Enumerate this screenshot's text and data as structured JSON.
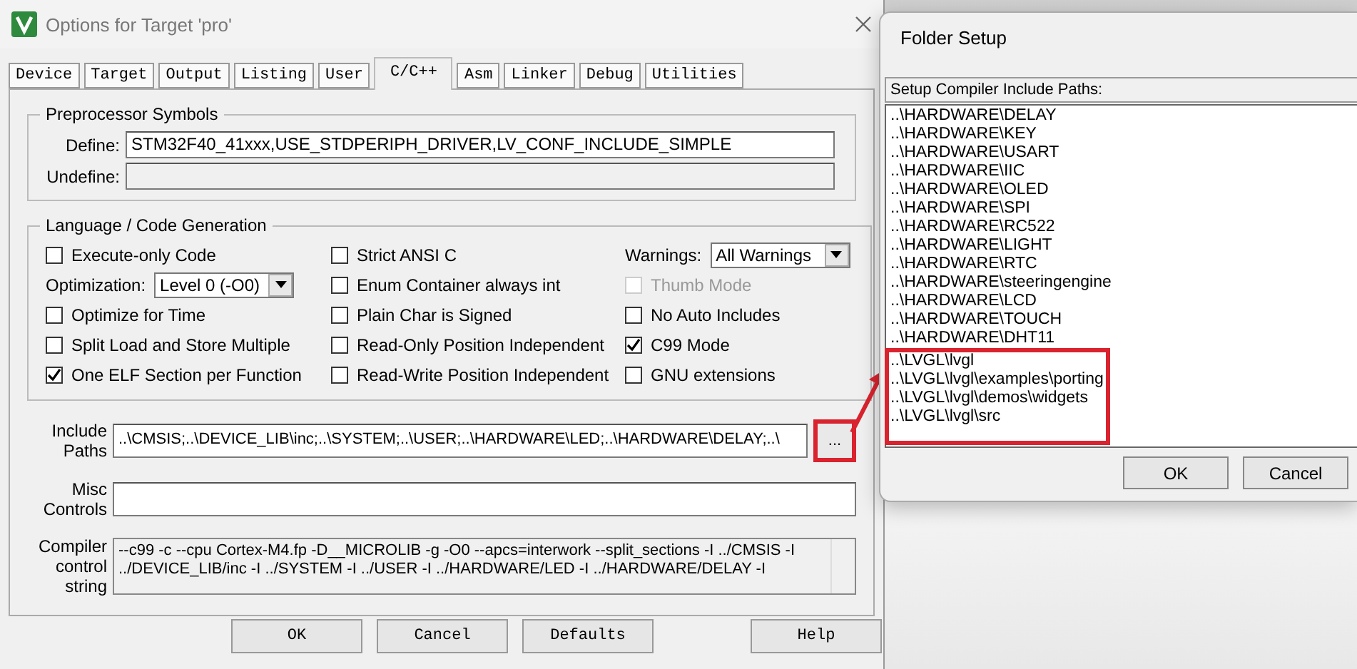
{
  "main_window": {
    "title": "Options for Target 'pro'"
  },
  "tabs": [
    {
      "label": "Device",
      "selected": false
    },
    {
      "label": "Target",
      "selected": false
    },
    {
      "label": "Output",
      "selected": false
    },
    {
      "label": "Listing",
      "selected": false
    },
    {
      "label": "User",
      "selected": false
    },
    {
      "label": "C/C++",
      "selected": true
    },
    {
      "label": "Asm",
      "selected": false
    },
    {
      "label": "Linker",
      "selected": false
    },
    {
      "label": "Debug",
      "selected": false
    },
    {
      "label": "Utilities",
      "selected": false
    }
  ],
  "preprocessor": {
    "title": "Preprocessor Symbols",
    "define_label": "Define:",
    "define_value": "STM32F40_41xxx,USE_STDPERIPH_DRIVER,LV_CONF_INCLUDE_SIMPLE",
    "undefine_label": "Undefine:"
  },
  "language": {
    "title": "Language / Code Generation",
    "columns": [
      [
        {
          "kind": "checkbox",
          "label": "Execute-only Code",
          "checked": false,
          "disabled": false
        },
        {
          "kind": "select",
          "label": "Optimization:",
          "value": "Level 0 (-O0)"
        },
        {
          "kind": "checkbox",
          "label": "Optimize for Time",
          "checked": false,
          "disabled": false
        },
        {
          "kind": "checkbox",
          "label": "Split Load and Store Multiple",
          "checked": false,
          "disabled": false
        },
        {
          "kind": "checkbox",
          "label": "One ELF Section per Function",
          "checked": true,
          "disabled": false
        }
      ],
      [
        {
          "kind": "checkbox",
          "label": "Strict ANSI C",
          "checked": false,
          "disabled": false
        },
        {
          "kind": "checkbox",
          "label": "Enum Container always int",
          "checked": false,
          "disabled": false
        },
        {
          "kind": "checkbox",
          "label": "Plain Char is Signed",
          "checked": false,
          "disabled": false
        },
        {
          "kind": "checkbox",
          "label": "Read-Only Position Independent",
          "checked": false,
          "disabled": false
        },
        {
          "kind": "checkbox",
          "label": "Read-Write Position Independent",
          "checked": false,
          "disabled": false
        }
      ],
      [
        {
          "kind": "select",
          "label": "Warnings:",
          "value": "All Warnings"
        },
        {
          "kind": "checkbox",
          "label": "Thumb Mode",
          "checked": false,
          "disabled": true
        },
        {
          "kind": "checkbox",
          "label": "No Auto Includes",
          "checked": false,
          "disabled": false
        },
        {
          "kind": "checkbox",
          "label": "C99 Mode",
          "checked": true,
          "disabled": false
        },
        {
          "kind": "checkbox",
          "label": "GNU extensions",
          "checked": false,
          "disabled": false
        }
      ]
    ]
  },
  "include_paths": {
    "label": "Include Paths",
    "value": "..\\CMSIS;..\\DEVICE_LIB\\inc;..\\SYSTEM;..\\USER;..\\HARDWARE\\LED;..\\HARDWARE\\DELAY;..\\",
    "browse": "...",
    "highlighted": true
  },
  "misc_controls": {
    "label": "Misc Controls"
  },
  "compiler_string": {
    "label": "Compiler control string",
    "value": "--c99 -c --cpu Cortex-M4.fp -D__MICROLIB -g -O0 --apcs=interwork --split_sections -I ../CMSIS -I ../DEVICE_LIB/inc -I ../SYSTEM -I ../USER -I ../HARDWARE/LED -I ../HARDWARE/DELAY -I"
  },
  "buttons": [
    "OK",
    "Cancel",
    "Defaults",
    "Help"
  ],
  "folder_setup": {
    "title": "Folder Setup",
    "list_label": "Setup Compiler Include Paths:",
    "paths": [
      {
        "text": "..\\HARDWARE\\DELAY",
        "highlighted": false
      },
      {
        "text": "..\\HARDWARE\\KEY",
        "highlighted": false
      },
      {
        "text": "..\\HARDWARE\\USART",
        "highlighted": false
      },
      {
        "text": "..\\HARDWARE\\IIC",
        "highlighted": false
      },
      {
        "text": "..\\HARDWARE\\OLED",
        "highlighted": false
      },
      {
        "text": "..\\HARDWARE\\SPI",
        "highlighted": false
      },
      {
        "text": "..\\HARDWARE\\RC522",
        "highlighted": false
      },
      {
        "text": "..\\HARDWARE\\LIGHT",
        "highlighted": false
      },
      {
        "text": "..\\HARDWARE\\RTC",
        "highlighted": false
      },
      {
        "text": "..\\HARDWARE\\steeringengine",
        "highlighted": false
      },
      {
        "text": "..\\HARDWARE\\LCD",
        "highlighted": false
      },
      {
        "text": "..\\HARDWARE\\TOUCH",
        "highlighted": false
      },
      {
        "text": "..\\HARDWARE\\DHT11",
        "highlighted": false
      },
      {
        "text": "..\\LVGL\\lvgl",
        "highlighted": true
      },
      {
        "text": "..\\LVGL\\lvgl\\examples\\porting",
        "highlighted": true
      },
      {
        "text": "..\\LVGL\\lvgl\\demos\\widgets",
        "highlighted": true
      },
      {
        "text": "..\\LVGL\\lvgl\\src",
        "highlighted": true
      }
    ],
    "buttons": [
      "OK",
      "Cancel"
    ]
  }
}
